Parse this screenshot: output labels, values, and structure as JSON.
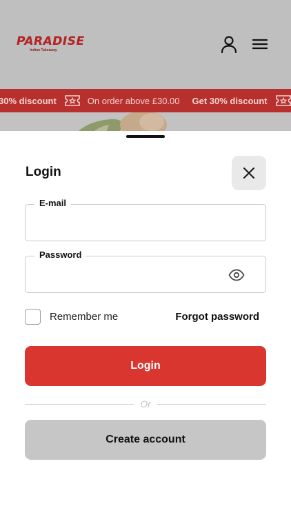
{
  "header": {
    "logo_main": "PARADISE",
    "logo_sub": "Indian Takeaway",
    "user_icon": "user-icon",
    "menu_icon": "hamburger-menu-icon"
  },
  "banner": {
    "items": [
      "30% discount",
      "On order above £30.00",
      "Get 30% discount"
    ],
    "icon": "ticket-icon"
  },
  "login": {
    "title": "Login",
    "close_icon": "close-icon",
    "email_label": "E-mail",
    "email_value": "",
    "password_label": "Password",
    "password_value": "",
    "eye_icon": "eye-icon",
    "remember_label": "Remember me",
    "remember_checked": false,
    "forgot_label": "Forgot password",
    "login_button": "Login",
    "or_text": "Or",
    "create_button": "Create account"
  },
  "colors": {
    "brand_red": "#d93630",
    "banner_red": "#b7302d",
    "overlay_gray": "#bfbfbf",
    "secondary_button": "#c6c6c6"
  }
}
